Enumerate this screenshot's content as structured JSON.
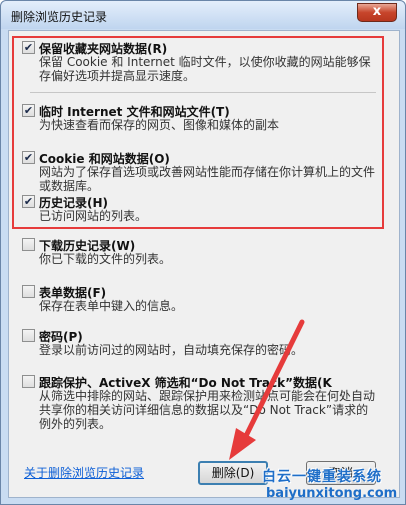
{
  "window": {
    "title": "删除浏览历史记录",
    "close_glyph": "x"
  },
  "options": [
    {
      "title": "保留收藏夹网站数据(R)",
      "desc": "保留 Cookie 和 Internet 临时文件，以使你收藏的网站能够保存偏好选项并提高显示速度。",
      "checked": true
    },
    {
      "title": "临时 Internet 文件和网站文件(T)",
      "desc": "为快速查看而保存的网页、图像和媒体的副本",
      "checked": true
    },
    {
      "title": "Cookie 和网站数据(O)",
      "desc": "网站为了保存首选项或改善网站性能而存储在你计算机上的文件或数据库。",
      "checked": true
    },
    {
      "title": "历史记录(H)",
      "desc": "已访问网站的列表。",
      "checked": true
    },
    {
      "title": "下载历史记录(W)",
      "desc": "你已下载的文件的列表。",
      "checked": false
    },
    {
      "title": "表单数据(F)",
      "desc": "保存在表单中键入的信息。",
      "checked": false
    },
    {
      "title": "密码(P)",
      "desc": "登录以前访问过的网站时，自动填充保存的密码。",
      "checked": false
    },
    {
      "title": "跟踪保护、ActiveX 筛选和“Do Not Track”数据(K",
      "desc": "从筛选中排除的网站、跟踪保护用来检测站点可能会在何处自动共享你的相关访问详细信息的数据以及“Do Not Track”请求的例外的列表。",
      "checked": false
    }
  ],
  "footer": {
    "link": "关于删除浏览历史记录",
    "delete_button": "删除(D)",
    "cancel_button": "取消"
  },
  "watermark": {
    "brand": "白云一键重装系统",
    "url": "baiyunxitong.com"
  },
  "colors": {
    "highlight_border": "#e63b3b",
    "arrow": "#e63b3b",
    "link": "#0d5fd6",
    "watermark": "#1e6ec8"
  }
}
